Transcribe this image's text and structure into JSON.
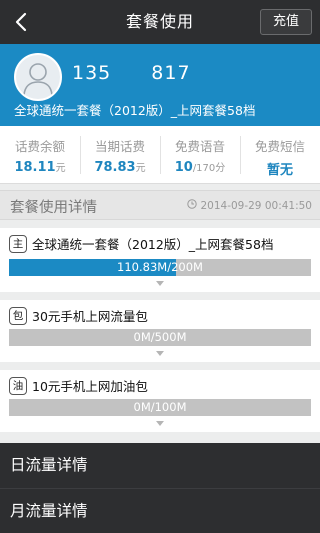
{
  "header": {
    "title": "套餐使用",
    "recharge_label": "充值"
  },
  "profile": {
    "phone_prefix": "135",
    "phone_suffix": "817",
    "plan_name": "全球通统一套餐（2012版）_上网套餐58档"
  },
  "stats": [
    {
      "label": "话费余额",
      "value": "18.11",
      "unit": "元"
    },
    {
      "label": "当期话费",
      "value": "78.83",
      "unit": "元"
    },
    {
      "label": "免费语音",
      "value": "10",
      "unit": "/170分"
    },
    {
      "label": "免费短信",
      "value": "暂无",
      "unit": ""
    }
  ],
  "section": {
    "title": "套餐使用详情",
    "timestamp": "2014-09-29 00:41:50"
  },
  "packages": [
    {
      "tag": "主",
      "name": "全球通统一套餐（2012版）_上网套餐58档",
      "usage_text": "110.83M/200M",
      "used_fraction": 0.554
    },
    {
      "tag": "包",
      "name": "30元手机上网流量包",
      "usage_text": "0M/500M",
      "used_fraction": 0
    },
    {
      "tag": "油",
      "name": "10元手机上网加油包",
      "usage_text": "0M/100M",
      "used_fraction": 0
    }
  ],
  "links": {
    "daily": "日流量详情",
    "monthly": "月流量详情"
  },
  "colors": {
    "accent": "#1b8ac4",
    "dark_bar": "#2d2e30"
  },
  "icons": {
    "back": "back-arrow-icon",
    "avatar": "avatar-icon",
    "clock": "clock-icon",
    "expand": "chevron-down-icon"
  }
}
